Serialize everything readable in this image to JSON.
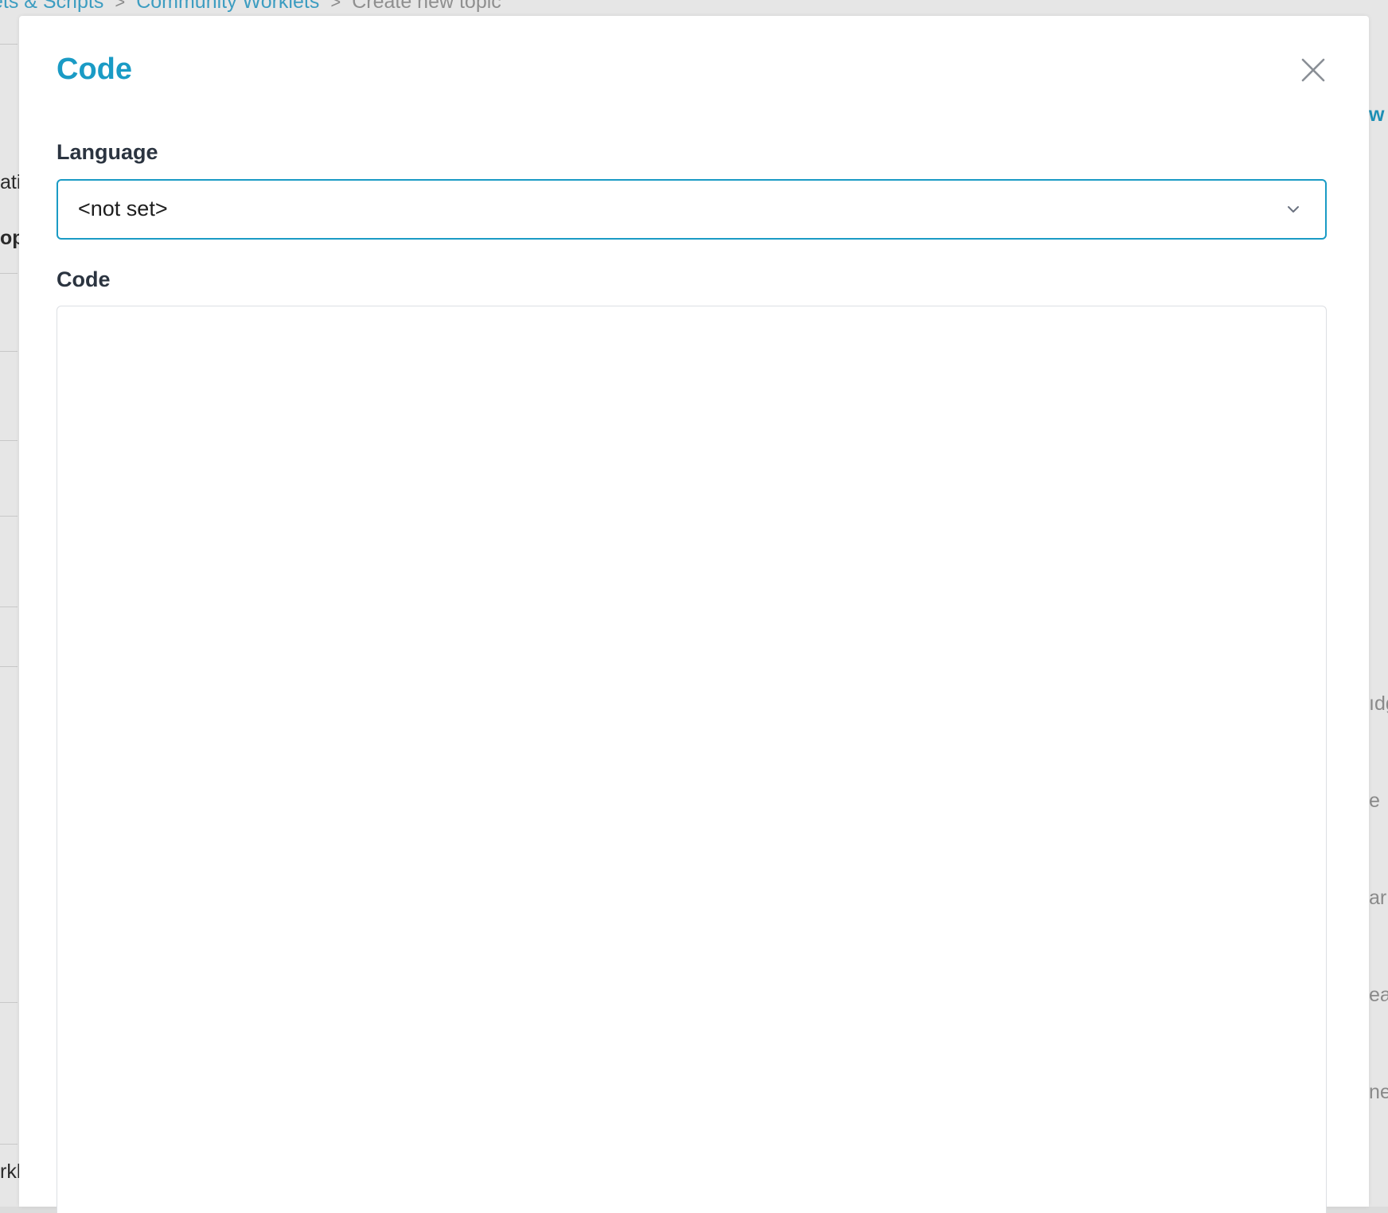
{
  "background": {
    "breadcrumb": {
      "item1": "ets & Scripts",
      "item2": "Community Worklets",
      "current": "Create new topic",
      "separator": ">"
    },
    "left_fragments": {
      "frag1": "atio",
      "frag2": "op",
      "frag3": "rkl"
    },
    "right_fragments": {
      "frag1": "w",
      "frag2": "ıdg",
      "frag3": "e",
      "frag4": "ar",
      "frag5": "ea",
      "frag6": "ne"
    }
  },
  "modal": {
    "title": "Code",
    "close_icon": "close-icon",
    "language": {
      "label": "Language",
      "selected": "<not set>",
      "chevron_icon": "chevron-down-icon"
    },
    "code": {
      "label": "Code",
      "value": ""
    }
  },
  "colors": {
    "accent": "#1a9bc5",
    "label": "#2b3440",
    "border": "#dcdfe3"
  }
}
